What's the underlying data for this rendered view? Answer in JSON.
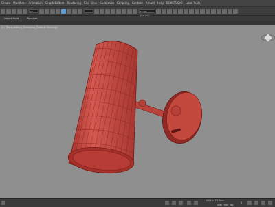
{
  "menu": [
    {
      "label": "Create"
    },
    {
      "label": "Modifiers"
    },
    {
      "label": "Animation"
    },
    {
      "label": "Graph Editors"
    },
    {
      "label": "Rendering"
    },
    {
      "label": "Civil View"
    },
    {
      "label": "Customize"
    },
    {
      "label": "Scripting"
    },
    {
      "label": "Content"
    },
    {
      "label": "Arnold"
    },
    {
      "label": "Help"
    },
    {
      "label": "BOXSTUDIO"
    },
    {
      "label": "Label Tools"
    }
  ],
  "toolbar": {
    "filter_value": "All",
    "selection_set_value": "Create Selection Se..."
  },
  "ribbon": {
    "tabs": [
      {
        "label": "Object Paint"
      },
      {
        "label": "Populate"
      }
    ]
  },
  "viewport": {
    "label": "[+] [Perspective] [Standard] [Default Shading]",
    "model_color": "#c54a42",
    "wire_color": "#8a1f1a",
    "background": "#8f8f8f"
  },
  "status": {
    "grid_label": "Grid = 10,0cm",
    "time_tag_label": "Add Time Tag",
    "frame_value": "0"
  },
  "colors": {
    "accent": "#5b9bd5",
    "ui_dark": "#2b2b2b"
  }
}
